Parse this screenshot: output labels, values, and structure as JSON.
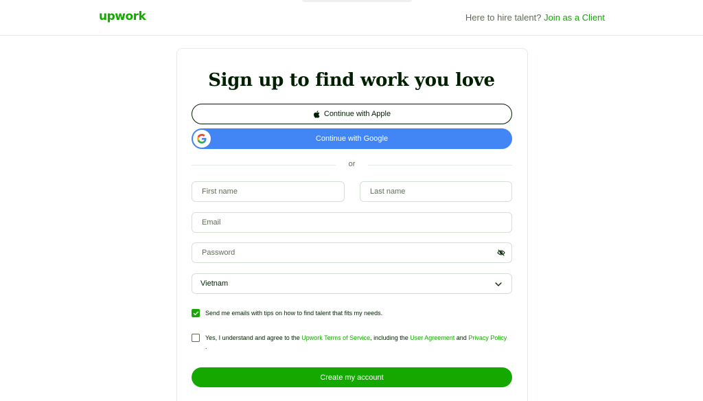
{
  "header": {
    "logo": "upwork",
    "hire_prompt": "Here to hire talent?",
    "join_client": "Join as a Client"
  },
  "form": {
    "title": "Sign up to find work you love",
    "apple_button": "Continue with Apple",
    "google_button": "Continue with Google",
    "divider": "or",
    "first_name_placeholder": "First name",
    "last_name_placeholder": "Last name",
    "email_placeholder": "Email",
    "password_placeholder": "Password",
    "country": "Vietnam",
    "email_tips": {
      "checked": true,
      "label": "Send me emails with tips on how to find talent that fits my needs."
    },
    "terms": {
      "checked": false,
      "prefix": "Yes, I understand and agree to the",
      "terms_link": "Upwork Terms of Service",
      "middle": ", including the",
      "user_agreement_link": "User Agreement",
      "and": "and",
      "privacy_link": "Privacy Policy",
      "suffix": "."
    },
    "create_button": "Create my account"
  },
  "colors": {
    "brand": "#14a800",
    "google": "#4285f4",
    "text": "#001e00",
    "muted": "#5e6d55"
  },
  "icons": {
    "apple": "apple-icon",
    "google": "google-icon",
    "eye": "eye-off-icon",
    "chevron": "chevron-down-icon",
    "check": "check-icon"
  }
}
